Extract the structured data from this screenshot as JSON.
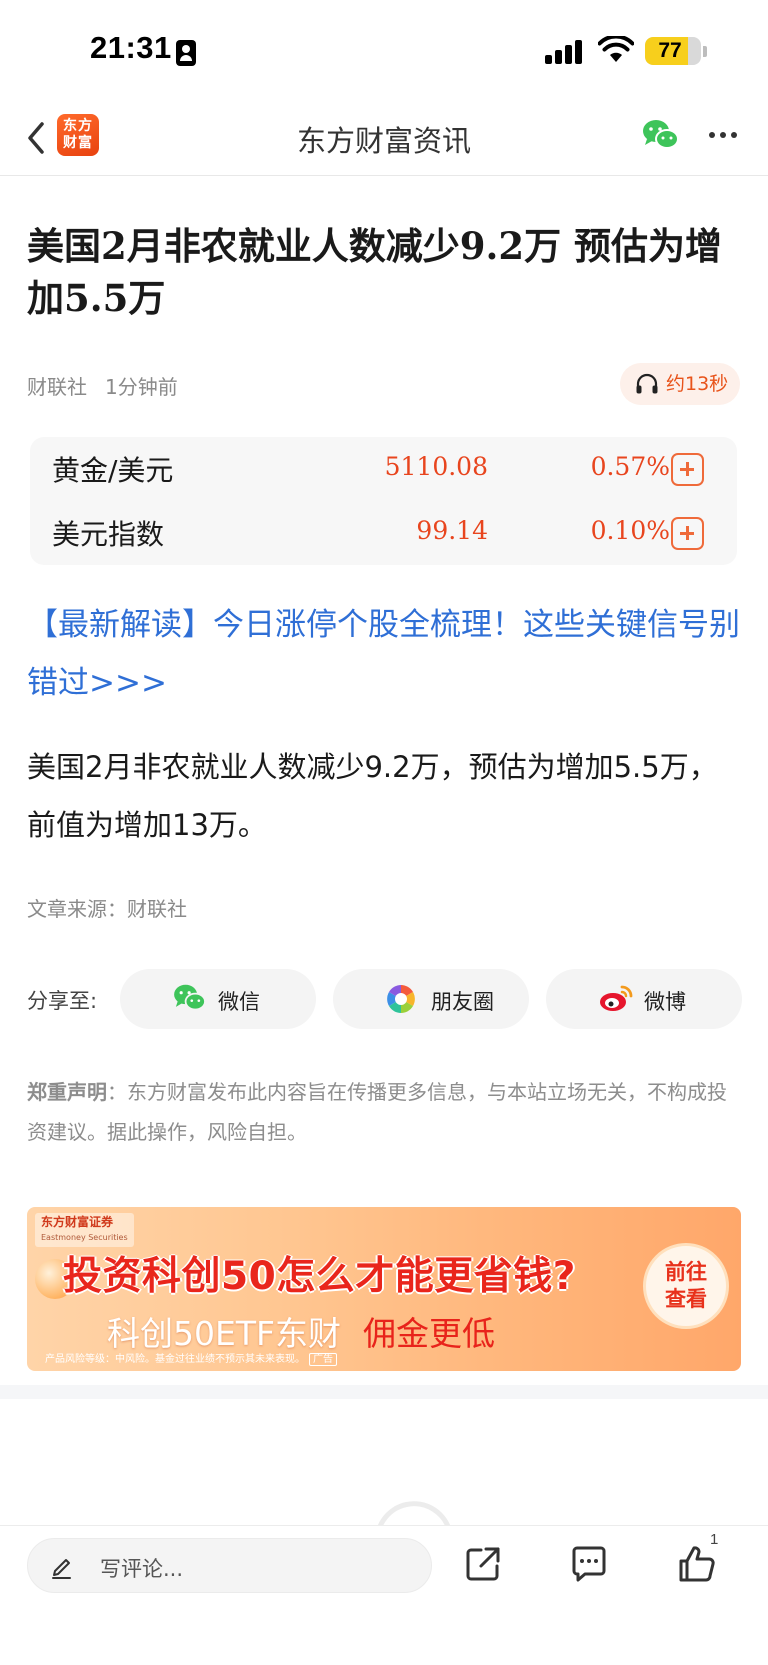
{
  "status_bar": {
    "time": "21:31",
    "battery": "77",
    "battery_level": 0.77,
    "battery_color": "#f7cf1c"
  },
  "nav": {
    "logo_text": "东方财富",
    "title": "东方财富资讯",
    "back_icon": "chevron-left-icon",
    "share_icon": "wechat-icon",
    "more_icon": "more-dots-icon"
  },
  "article": {
    "headline": "美国2月非农就业人数减少9.2万 预估为增加5.5万",
    "source_name": "财联社",
    "time_ago": "1分钟前",
    "audio_label": "约13秒",
    "promo": "【最新解读】今日涨停个股全梳理！这些关键信号别错过>>>",
    "body": "美国2月非农就业人数减少9.2万，预估为增加5.5万，前值为增加13万。",
    "source_line": "文章来源：财联社"
  },
  "quotes": [
    {
      "name": "黄金/美元",
      "price": "5110.08",
      "change": "0.57%"
    },
    {
      "name": "美元指数",
      "price": "99.14",
      "change": "0.10%"
    }
  ],
  "share": {
    "label": "分享至:",
    "buttons": [
      {
        "label": "微信",
        "icon": "wechat-icon"
      },
      {
        "label": "朋友圈",
        "icon": "moments-icon"
      },
      {
        "label": "微博",
        "icon": "weibo-icon"
      }
    ]
  },
  "disclaimer": {
    "title": "郑重声明",
    "text": "：东方财富发布此内容旨在传播更多信息，与本站立场无关，不构成投资建议。据此操作，风险自担。"
  },
  "ad": {
    "brand": "东方财富证券",
    "brand_en": "Eastmoney Securities",
    "headline": "投资科创50怎么才能更省钱?",
    "sub1": "科创50ETF东财",
    "sub2": "佣金更低",
    "cta_line1": "前往",
    "cta_line2": "查看",
    "risk": "产品风险等级：中风险。基金过往业绩不预示其未来表现。",
    "tag": "广告"
  },
  "bottom_bar": {
    "comment_placeholder": "写评论...",
    "like_count": "1"
  },
  "colors": {
    "accent_red": "#e8451e",
    "link_blue": "#2f6fd6",
    "brand_orange": "#ff6a2b"
  }
}
